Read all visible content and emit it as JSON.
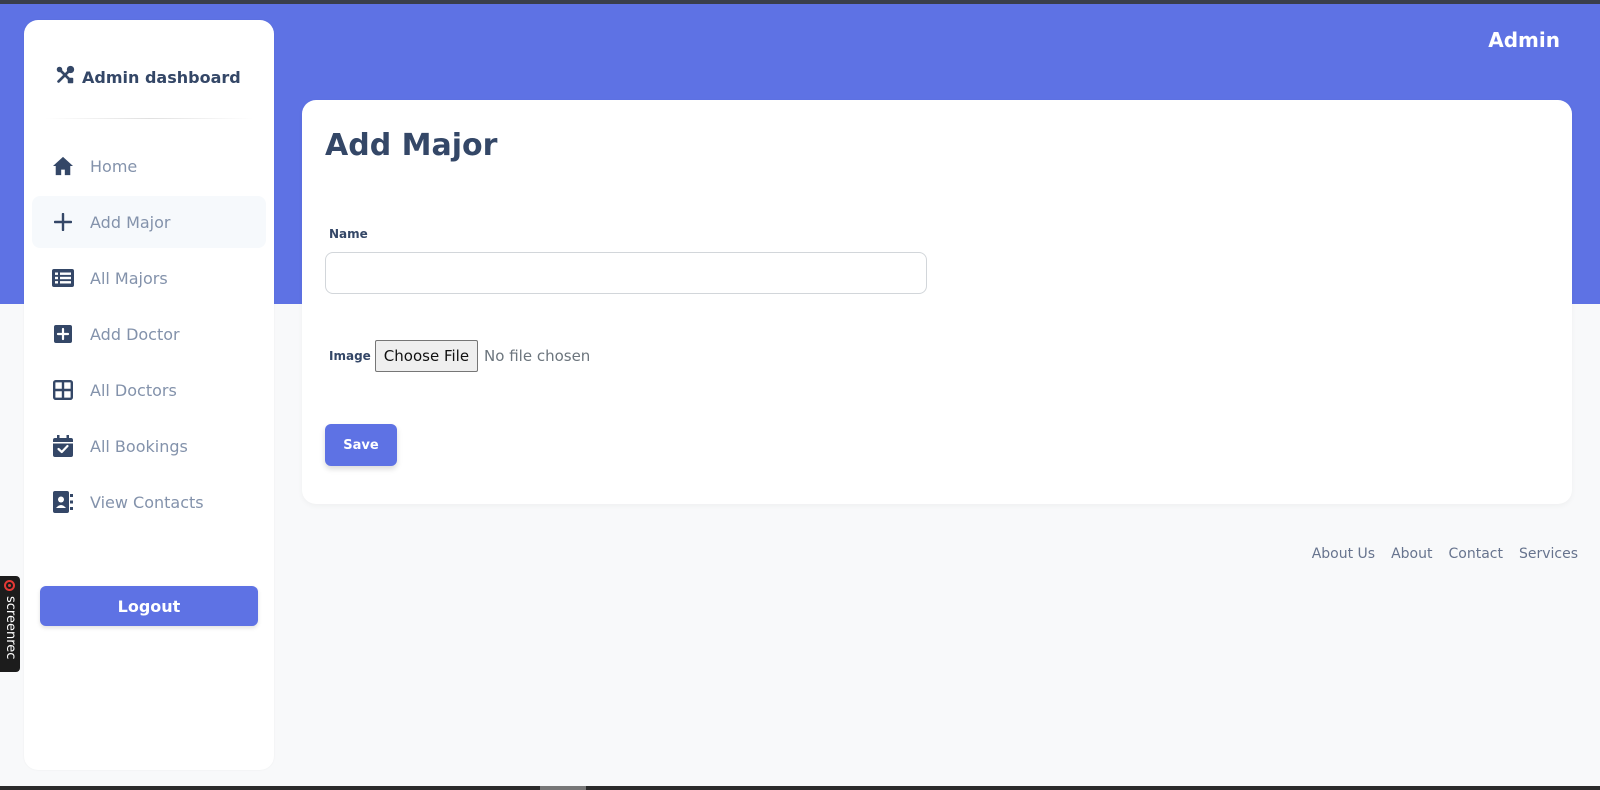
{
  "colors": {
    "accent": "#5e72e4",
    "text_dark": "#344767",
    "text_muted": "#8392ab",
    "page_bg": "#f8f9fa"
  },
  "sidebar": {
    "brand": {
      "icon": "tools-icon",
      "title": "Admin dashboard"
    },
    "items": [
      {
        "label": "Home",
        "icon": "home-icon",
        "active": false
      },
      {
        "label": "Add Major",
        "icon": "plus-icon",
        "active": true
      },
      {
        "label": "All Majors",
        "icon": "list-icon",
        "active": false
      },
      {
        "label": "Add Doctor",
        "icon": "plus-square-icon",
        "active": false
      },
      {
        "label": "All Doctors",
        "icon": "grid-icon",
        "active": false
      },
      {
        "label": "All Bookings",
        "icon": "calendar-check-icon",
        "active": false
      },
      {
        "label": "View Contacts",
        "icon": "address-book-icon",
        "active": false
      }
    ],
    "logout_label": "Logout"
  },
  "header": {
    "user": "Admin"
  },
  "main": {
    "title": "Add Major",
    "form": {
      "name_label": "Name",
      "name_value": "",
      "image_label": "Image",
      "file_button": "Choose File",
      "file_status": "No file chosen",
      "save_label": "Save"
    }
  },
  "footer": {
    "links": [
      "About Us",
      "About",
      "Contact",
      "Services"
    ]
  },
  "overlay": {
    "screenrec_label": "screenrec"
  }
}
